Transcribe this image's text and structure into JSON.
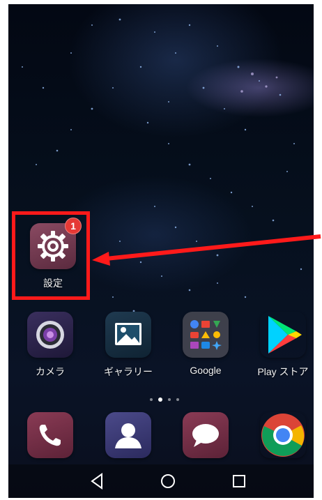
{
  "apps": {
    "settings": {
      "label": "設定",
      "badge": "1",
      "icon": "gear-icon"
    },
    "camera": {
      "label": "カメラ",
      "icon": "camera-icon"
    },
    "gallery": {
      "label": "ギャラリー",
      "icon": "gallery-icon"
    },
    "google": {
      "label": "Google",
      "icon": "google-folder-icon"
    },
    "play_store": {
      "label": "Play ストア",
      "icon": "play-store-icon"
    }
  },
  "dock": [
    {
      "name": "phone",
      "icon": "phone-icon"
    },
    {
      "name": "contacts",
      "icon": "contacts-icon"
    },
    {
      "name": "messages",
      "icon": "message-icon"
    },
    {
      "name": "chrome",
      "icon": "chrome-icon"
    }
  ],
  "page_indicator": {
    "pages": 4,
    "current": 2
  },
  "navigation": {
    "back": "back-icon",
    "home": "home-icon",
    "recents": "recents-icon"
  },
  "annotation": {
    "highlight_color": "#ff1a1a"
  }
}
